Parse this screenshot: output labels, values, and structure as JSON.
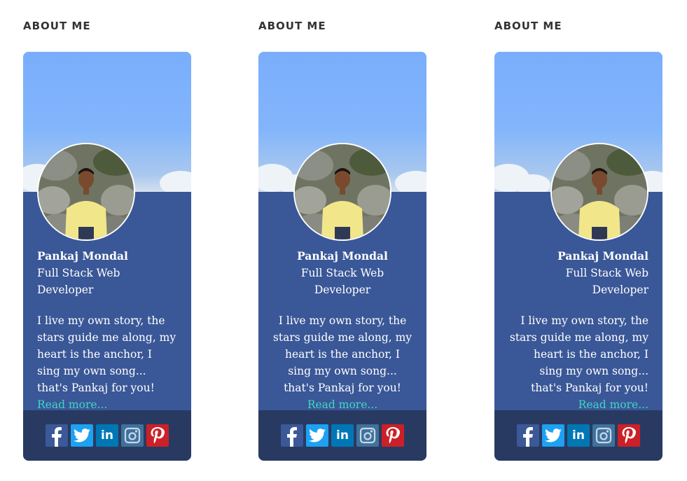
{
  "widgets": [
    {
      "heading": "ABOUT ME",
      "name": "Pankaj Mondal",
      "role": "Full Stack Web Developer",
      "bio": "I live my own story, the stars guide me along, my heart is the anchor, I sing my own song... that's Pankaj for you!",
      "read_more": "Read more...",
      "align": "left"
    },
    {
      "heading": "ABOUT ME",
      "name": "Pankaj Mondal",
      "role": "Full Stack Web Developer",
      "bio": "I live my own story, the stars guide me along, my heart is the anchor, I sing my own song... that's Pankaj for you!",
      "read_more": "Read more...",
      "align": "center"
    },
    {
      "heading": "ABOUT ME",
      "name": "Pankaj Mondal",
      "role": "Full Stack Web Developer",
      "bio": "I live my own story, the stars guide me along, my heart is the anchor, I sing my own song... that's Pankaj for you!",
      "read_more": "Read more...",
      "align": "right"
    }
  ],
  "social": [
    {
      "icon": "facebook-icon",
      "color": "#3b5998"
    },
    {
      "icon": "twitter-icon",
      "color": "#1da1f2"
    },
    {
      "icon": "linkedin-icon",
      "color": "#0077b5"
    },
    {
      "icon": "instagram-icon",
      "color": "#3f729b"
    },
    {
      "icon": "pinterest-icon",
      "color": "#cb2027"
    }
  ],
  "colors": {
    "card": "#3a5797",
    "footer": "#283a62",
    "link": "#3ed7c2",
    "heading": "#333333"
  }
}
